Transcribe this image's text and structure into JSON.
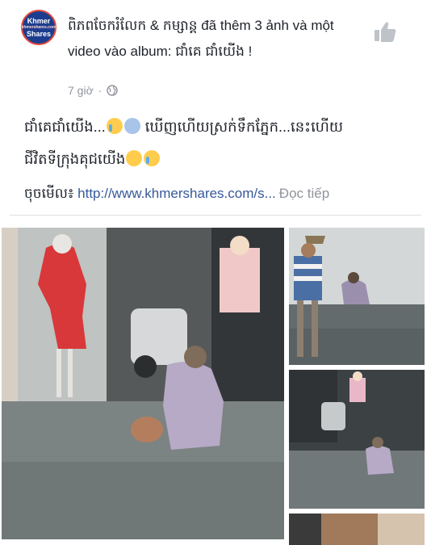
{
  "page": {
    "name": "ពិភពចែករំលែក & កម្សាន្ត",
    "action_text": " đã thêm 3 ảnh và một video vào album: ",
    "album": "ជាំគេ ជាំយើង !",
    "avatar": {
      "line1": "Khmer",
      "line2": "khmershares.com",
      "line3": "Shares"
    }
  },
  "meta": {
    "time": "7 giờ",
    "separator": "·",
    "privacy_icon": "globe-icon"
  },
  "post": {
    "line1_a": "ជាំគេជាំយើង...",
    "line1_b": " ឃើញហើយស្រក់ទឹកភ្នែក...នេះហើយ",
    "line2": "ជីវិតទីក្រុងគុជយើង",
    "link_prefix": "ចុចមើល៖ ",
    "link": "http://www.khmershares.com/s...",
    "more": "Đọc tiếp"
  },
  "icons": {
    "like": "thumbs-up-icon"
  },
  "colors": {
    "link": "#365899",
    "meta": "#90949c",
    "text": "#1d2129",
    "like_icon": "#bec3c9"
  }
}
